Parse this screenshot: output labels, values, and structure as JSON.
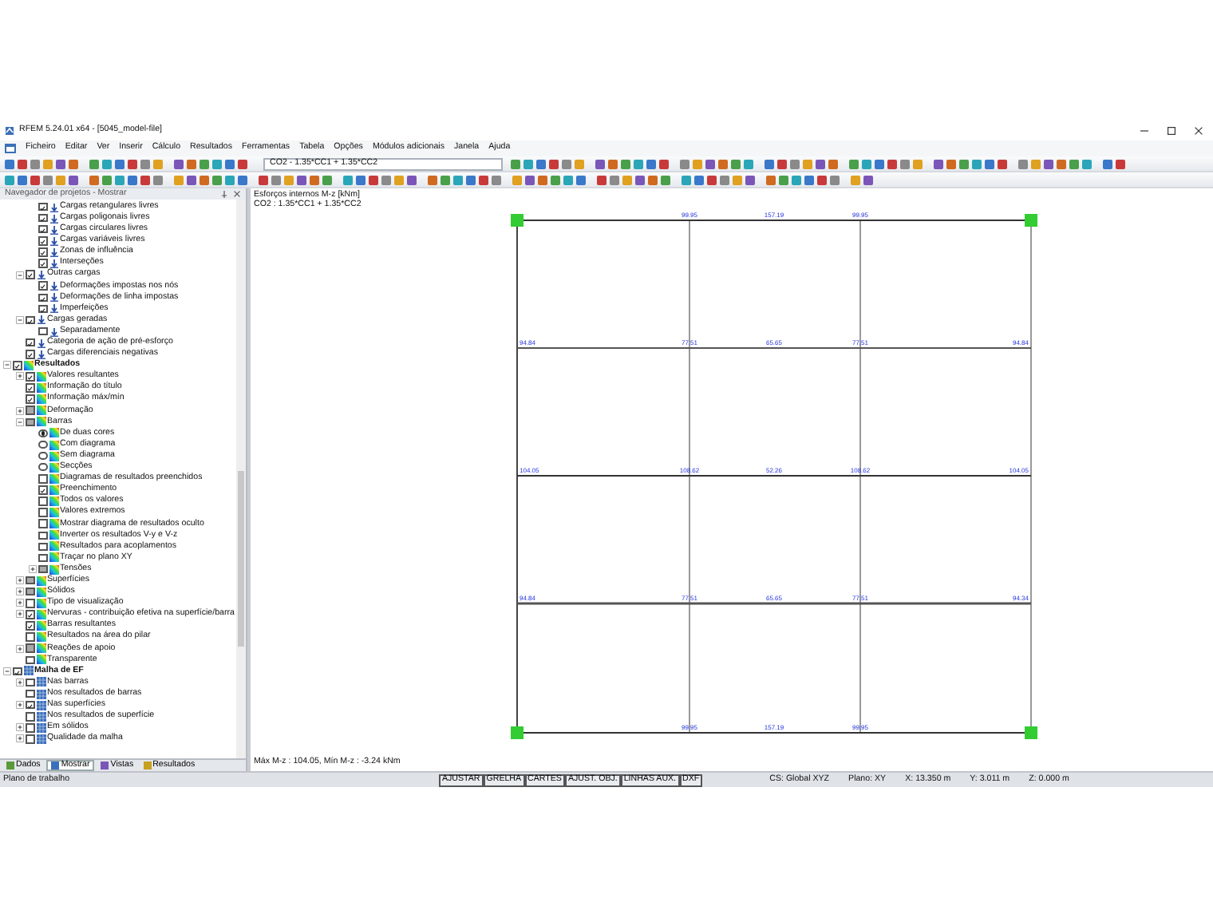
{
  "window": {
    "title": "RFEM 5.24.01 x64 - [5045_model-file]"
  },
  "menu": [
    "Ficheiro",
    "Editar",
    "Ver",
    "Inserir",
    "Cálculo",
    "Resultados",
    "Ferramentas",
    "Tabela",
    "Opções",
    "Módulos adicionais",
    "Janela",
    "Ajuda"
  ],
  "toolbar": {
    "load_combination": "CO2 - 1.35*CC1 + 1.35*CC2"
  },
  "navigator": {
    "title": "Navegador de projetos - Mostrar",
    "tree": [
      {
        "children": [
          {
            "children": [
              {
                "label": "Cargas retangulares livres",
                "kind": "load",
                "checked": true,
                "partial": false
              },
              {
                "label": "Cargas poligonais livres",
                "kind": "load",
                "checked": true,
                "partial": false
              },
              {
                "label": "Cargas circulares livres",
                "kind": "load",
                "checked": true,
                "partial": false
              },
              {
                "label": "Cargas variáveis livres",
                "kind": "load",
                "checked": true,
                "partial": false
              },
              {
                "label": "Zonas de influência",
                "kind": "load",
                "checked": true,
                "partial": false
              },
              {
                "label": "Interseções",
                "kind": "load",
                "checked": true,
                "partial": false
              }
            ]
          },
          {
            "label": "Outras cargas",
            "kind": "load",
            "checked": true,
            "partial": false,
            "expanded": true,
            "children": [
              {
                "label": "Deformações impostas nos nós",
                "kind": "load",
                "checked": true,
                "partial": false
              },
              {
                "label": "Deformações de linha impostas",
                "kind": "load",
                "checked": true,
                "partial": false
              },
              {
                "label": "Imperfeições",
                "kind": "load",
                "checked": true,
                "partial": false
              }
            ]
          },
          {
            "label": "Cargas geradas",
            "kind": "load",
            "checked": true,
            "partial": false,
            "expanded": true,
            "children": [
              {
                "label": "Separadamente",
                "kind": "load",
                "checked": false,
                "partial": false
              }
            ]
          },
          {
            "label": "Categoria de ação de pré-esforço",
            "kind": "load",
            "checked": true,
            "partial": false
          },
          {
            "label": "Cargas diferenciais negativas",
            "kind": "load",
            "checked": true,
            "partial": false
          }
        ]
      },
      {
        "label": "Resultados",
        "kind": "result",
        "checked": true,
        "partial": false,
        "expanded": true,
        "children": [
          {
            "label": "Valores resultantes",
            "kind": "result",
            "checked": true,
            "partial": false,
            "expanded": false
          },
          {
            "label": "Informação do título",
            "kind": "result",
            "checked": true,
            "partial": false
          },
          {
            "label": "Informação máx/mín",
            "kind": "result",
            "checked": true,
            "partial": false
          },
          {
            "label": "Deformação",
            "kind": "result",
            "checked": false,
            "partial": true,
            "expanded": false
          },
          {
            "label": "Barras",
            "kind": "result",
            "checked": false,
            "partial": true,
            "expanded": true,
            "children": [
              {
                "label": "De duas cores",
                "kind": "result",
                "selected": true
              },
              {
                "label": "Com diagrama",
                "kind": "result",
                "selected": false
              },
              {
                "label": "Sem diagrama",
                "kind": "result",
                "selected": false
              },
              {
                "label": "Secções",
                "kind": "result",
                "selected": false
              },
              {
                "label": "Diagramas de resultados preenchidos",
                "kind": "result",
                "checked": false,
                "partial": false
              },
              {
                "label": "Preenchimento",
                "kind": "result",
                "checked": true,
                "partial": false
              },
              {
                "label": "Todos os valores",
                "kind": "result",
                "checked": false,
                "partial": false
              },
              {
                "label": "Valores extremos",
                "kind": "result",
                "checked": false,
                "partial": false
              },
              {
                "label": "Mostrar diagrama de resultados oculto",
                "kind": "result",
                "checked": false,
                "partial": false
              },
              {
                "label": "Inverter os resultados V-y e V-z",
                "kind": "result",
                "checked": false,
                "partial": false
              },
              {
                "label": "Resultados para acoplamentos",
                "kind": "result",
                "checked": false,
                "partial": false
              },
              {
                "label": "Traçar no plano XY",
                "kind": "result",
                "checked": false,
                "partial": false
              },
              {
                "label": "Tensões",
                "kind": "result",
                "checked": false,
                "partial": true,
                "expanded": false
              }
            ]
          },
          {
            "label": "Superfícies",
            "kind": "result",
            "checked": false,
            "partial": true,
            "expanded": false
          },
          {
            "label": "Sólidos",
            "kind": "result",
            "checked": false,
            "partial": true,
            "expanded": false
          },
          {
            "label": "Tipo de visualização",
            "kind": "result",
            "checked": false,
            "partial": false,
            "expanded": false
          },
          {
            "label": "Nervuras - contribuição efetiva na superfície/barra",
            "kind": "result",
            "checked": true,
            "partial": false,
            "expanded": false
          },
          {
            "label": "Barras resultantes",
            "kind": "result",
            "checked": true,
            "partial": false
          },
          {
            "label": "Resultados na área do pilar",
            "kind": "result",
            "checked": false,
            "partial": false
          },
          {
            "label": "Reações de apoio",
            "kind": "result",
            "checked": false,
            "partial": true,
            "expanded": false
          },
          {
            "label": "Transparente",
            "kind": "result",
            "checked": false,
            "partial": false
          }
        ]
      },
      {
        "label": "Malha de EF",
        "kind": "mesh",
        "checked": true,
        "partial": false,
        "expanded": true,
        "children": [
          {
            "label": "Nas barras",
            "kind": "mesh",
            "checked": false,
            "partial": false,
            "expanded": false
          },
          {
            "label": "Nos resultados de barras",
            "kind": "mesh",
            "checked": false,
            "partial": false
          },
          {
            "label": "Nas superfícies",
            "kind": "mesh",
            "checked": true,
            "partial": false,
            "expanded": false
          },
          {
            "label": "Nos resultados de superfície",
            "kind": "mesh",
            "checked": false,
            "partial": false
          },
          {
            "label": "Em sólidos",
            "kind": "mesh",
            "checked": false,
            "partial": false,
            "expanded": false
          },
          {
            "label": "Qualidade da malha",
            "kind": "mesh",
            "checked": false,
            "partial": false,
            "expanded": false
          }
        ]
      }
    ],
    "tabs": [
      {
        "label": "Dados",
        "selected": false
      },
      {
        "label": "Mostrar",
        "selected": true
      },
      {
        "label": "Vistas",
        "selected": false
      },
      {
        "label": "Resultados",
        "selected": false
      }
    ]
  },
  "view": {
    "title": "Esforços internos M-z [kNm]",
    "subtitle": "CO2 : 1.35*CC1 + 1.35*CC2",
    "rows": [
      {
        "labels": [
          "99.95",
          "157.19",
          "99.95"
        ]
      },
      {
        "labels": [
          "94.84",
          "77.51",
          "65.65",
          "77.51",
          "94.84"
        ]
      },
      {
        "labels": [
          "104.05",
          "108.62",
          "52.26",
          "108.62",
          "104.05"
        ]
      },
      {
        "labels": [
          "94.84",
          "77.51",
          "65.65",
          "77.51",
          "94.34"
        ]
      },
      {
        "labels": [
          "99.95",
          "157.19",
          "99.95"
        ]
      }
    ],
    "summary": "Máx M-z : 104.05, Mín M-z : -3.24 kNm"
  },
  "status_bar": {
    "left": "Plano de trabalho",
    "toggles": [
      "AJUSTAR",
      "GRELHA",
      "CARTES",
      "AJUST. OBJ.",
      "LINHAS AUX.",
      "DXF"
    ],
    "cs": "CS: Global XYZ",
    "plane": "Plano: XY",
    "x": "X: 13.350 m",
    "y": "Y: 3.011 m",
    "z": "Z: 0.000 m"
  }
}
